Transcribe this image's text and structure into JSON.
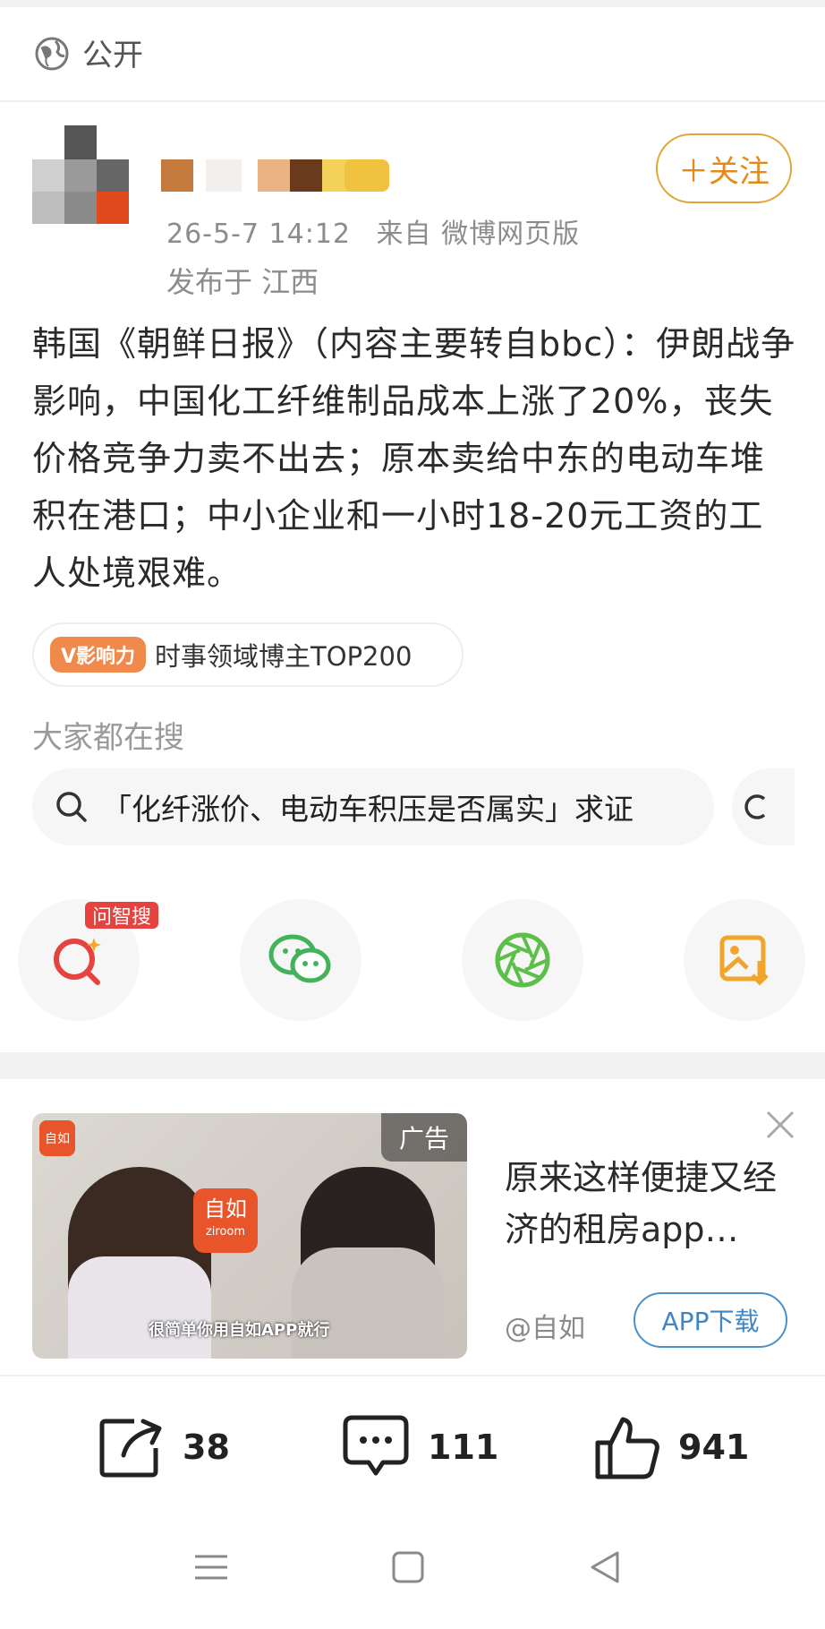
{
  "visibility": {
    "label": "公开",
    "icon": "globe-icon"
  },
  "author": {
    "avatar": "avatar",
    "meta_time": "26-5-7 14:12",
    "meta_source": "来自 微博网页版",
    "location": "发布于 江西",
    "follow_label": "＋关注"
  },
  "post": {
    "text": "韩国《朝鲜日报》（内容主要转自bbc）：伊朗战争影响，中国化工纤维制品成本上涨了20%，丧失价格竞争力卖不出去；原本卖给中东的电动车堆积在港口；中小企业和一小时18-20元工资的工人处境艰难。"
  },
  "badge": {
    "logo": "V影响力",
    "text": "时事领域博主TOP200"
  },
  "search": {
    "heading": "大家都在搜",
    "query": "「化纤涨价、电动车积压是否属实」求证"
  },
  "share": {
    "wenzhisou_tag": "问智搜",
    "icons": [
      "wenzhisou-search-icon",
      "wechat-icon",
      "moments-icon",
      "save-image-icon"
    ]
  },
  "ad": {
    "tag": "广告",
    "title": "原来这样便捷又经济的租房app…",
    "source": "@自如",
    "button": "APP下载",
    "image_logo": "自如",
    "image_logo_sub": "ziroom",
    "image_caption": "很简单你用自如APP就行"
  },
  "actions": {
    "repost_count": "38",
    "comment_count": "111",
    "like_count": "941"
  },
  "colors": {
    "accent_orange": "#e58a1a",
    "ad_button_blue": "#3f86c3",
    "wechat_green": "#43b25b",
    "search_red": "#e64340"
  }
}
